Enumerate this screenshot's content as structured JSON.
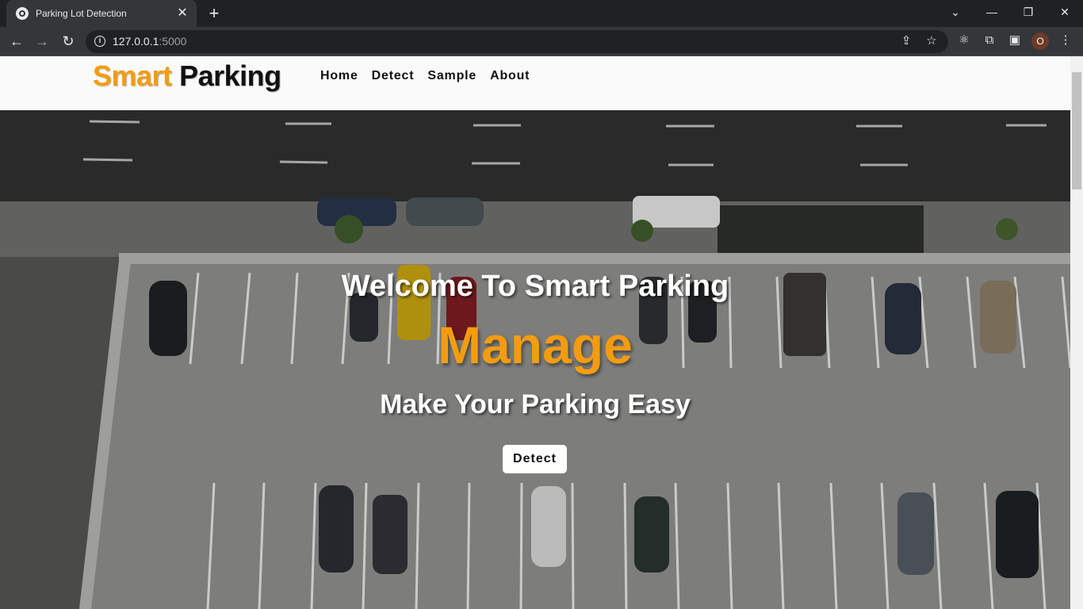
{
  "browser": {
    "tab_title": "Parking Lot Detection",
    "tab_close": "✕",
    "new_tab": "+",
    "url_host": "127.0.0.1",
    "url_port": ":5000",
    "profile_initial": "O"
  },
  "site": {
    "logo_part1": "Smart",
    "logo_part2": "Parking",
    "nav": [
      "Home",
      "Detect",
      "Sample",
      "About"
    ],
    "accent_color": "#f39c12"
  },
  "hero": {
    "welcome": "Welcome To Smart Parking",
    "headline": "Manage",
    "tagline": "Make Your Parking Easy",
    "button_label": "Detect"
  },
  "icons": [
    "globe-icon",
    "close-icon",
    "plus-icon",
    "chevron-down-icon",
    "minimize-icon",
    "restore-icon",
    "window-close-icon",
    "back-arrow-icon",
    "forward-arrow-icon",
    "reload-icon",
    "info-icon",
    "share-icon",
    "star-icon",
    "react-devtools-icon",
    "puzzle-icon",
    "side-panel-icon",
    "kebab-menu-icon"
  ]
}
